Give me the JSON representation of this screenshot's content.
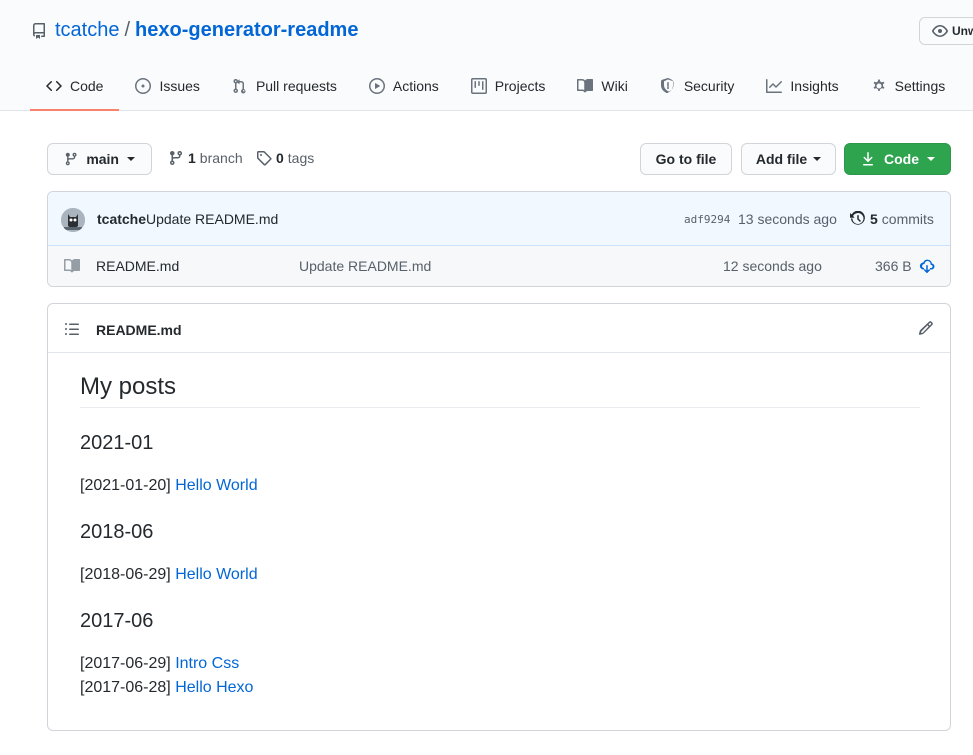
{
  "repo": {
    "owner": "tcatche",
    "separator": "/",
    "name": "hexo-generator-readme",
    "watch_label": "Unwatch"
  },
  "tabs": [
    {
      "label": "Code",
      "icon": "code-icon",
      "selected": true
    },
    {
      "label": "Issues",
      "icon": "issue-icon"
    },
    {
      "label": "Pull requests",
      "icon": "pull-request-icon"
    },
    {
      "label": "Actions",
      "icon": "play-icon"
    },
    {
      "label": "Projects",
      "icon": "project-icon"
    },
    {
      "label": "Wiki",
      "icon": "book-icon"
    },
    {
      "label": "Security",
      "icon": "shield-icon"
    },
    {
      "label": "Insights",
      "icon": "graph-icon"
    },
    {
      "label": "Settings",
      "icon": "gear-icon"
    }
  ],
  "toolbar": {
    "branch_name": "main",
    "branch_count": "1",
    "branch_label": "branch",
    "tag_count": "0",
    "tag_label": "tags",
    "goto_file": "Go to file",
    "add_file": "Add file",
    "code": "Code"
  },
  "commit": {
    "author": "tcatche",
    "message": "Update README.md",
    "sha": "adf9294",
    "time": "13 seconds ago",
    "count": "5",
    "count_label": "commits"
  },
  "files": [
    {
      "name": "README.md",
      "message": "Update README.md",
      "age": "12 seconds ago",
      "size": "366 B"
    }
  ],
  "readme": {
    "filename": "README.md",
    "heading": "My posts",
    "sections": [
      {
        "title": "2021-01",
        "posts": [
          {
            "date": "[2021-01-20]",
            "title": "Hello World"
          }
        ]
      },
      {
        "title": "2018-06",
        "posts": [
          {
            "date": "[2018-06-29]",
            "title": "Hello World"
          }
        ]
      },
      {
        "title": "2017-06",
        "posts": [
          {
            "date": "[2017-06-29]",
            "title": "Intro Css"
          },
          {
            "date": "[2017-06-28]",
            "title": "Hello Hexo"
          }
        ]
      }
    ]
  },
  "colors": {
    "link": "#0366d6",
    "primary_button": "#2ea44f",
    "selected_tab_underline": "#f9826c",
    "commit_bar": "#f1f8ff"
  }
}
